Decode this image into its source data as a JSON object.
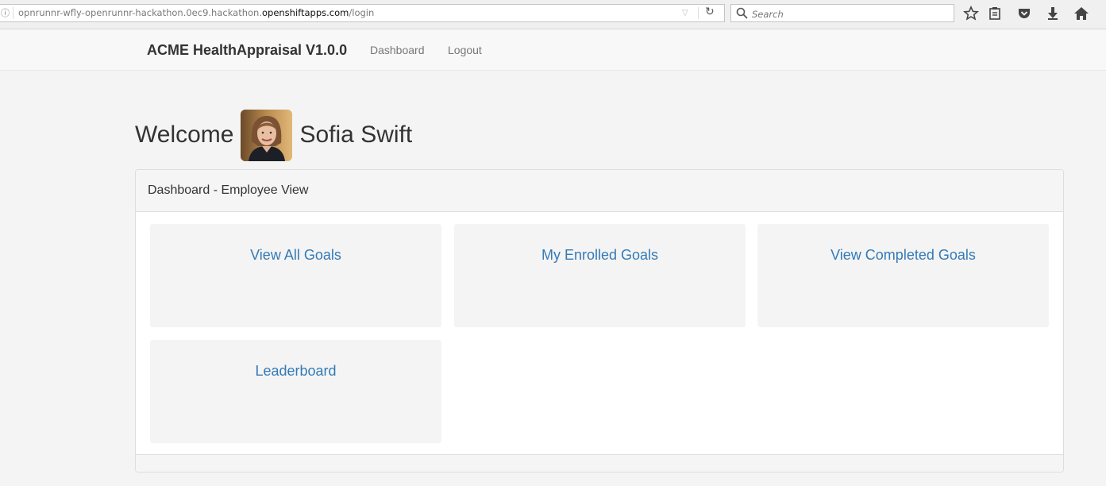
{
  "browser": {
    "url_prefix": "opnrunnr-wfly-openrunnr-hackathon.0ec9.hackathon.",
    "url_domain": "openshiftapps.com",
    "url_path": "/login",
    "search_placeholder": "Search",
    "info_icon": "info-icon",
    "toolbar_icons": [
      "bookmark-star-icon",
      "reading-list-icon",
      "pocket-icon",
      "download-icon",
      "home-icon"
    ]
  },
  "navbar": {
    "brand": "ACME HealthAppraisal V1.0.0",
    "links": [
      "Dashboard",
      "Logout"
    ]
  },
  "welcome": {
    "label": "Welcome",
    "user_name": "Sofia Swift"
  },
  "panel": {
    "heading": "Dashboard - Employee View",
    "tiles": [
      "View All Goals",
      "My Enrolled Goals",
      "View Completed Goals",
      "Leaderboard"
    ]
  },
  "colors": {
    "link": "#337ab7",
    "tile_bg": "#f4f4f4",
    "navbar_bg": "#f8f8f8"
  }
}
